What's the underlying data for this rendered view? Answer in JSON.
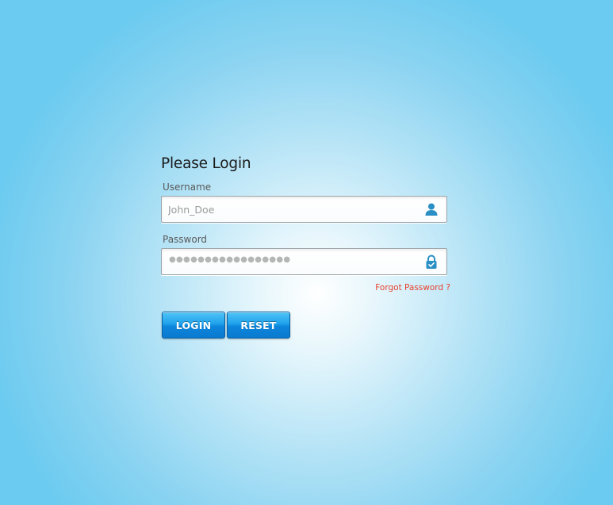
{
  "login_form": {
    "title": "Please Login",
    "username": {
      "label": "Username",
      "placeholder": "John_Doe",
      "icon": "user-icon"
    },
    "password": {
      "label": "Password",
      "masked_value": "●●●●●●●●●●●●●●●●●",
      "icon": "lock-icon"
    },
    "forgot_password": "Forgot Password ?",
    "buttons": {
      "login": "LOGIN",
      "reset": "RESET"
    }
  },
  "colors": {
    "accent": "#1fa2ec",
    "link": "#e8432f",
    "icon": "#2a8fc4"
  }
}
